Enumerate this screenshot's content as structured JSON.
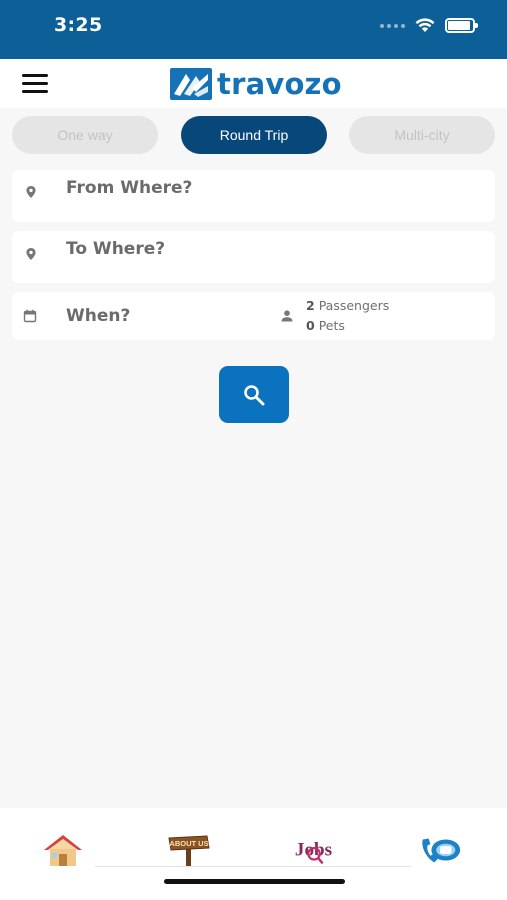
{
  "status_bar": {
    "time": "3:25",
    "icons": [
      "signal-icon",
      "wifi-icon",
      "battery-icon"
    ]
  },
  "header": {
    "menu_icon": "hamburger-menu-icon",
    "logo_text": "travozo"
  },
  "trip_types": [
    {
      "label": "One way",
      "active": false
    },
    {
      "label": "Round Trip",
      "active": true
    },
    {
      "label": "Multi-city",
      "active": false
    }
  ],
  "form": {
    "from": {
      "icon": "location-pin-icon",
      "text": "From Where?"
    },
    "to": {
      "icon": "location-pin-icon",
      "text": "To Where?"
    },
    "when": {
      "icon": "calendar-icon",
      "text": "When?"
    },
    "travelers": {
      "icon": "person-icon",
      "passengers_count": "2",
      "passengers_label": "Passengers",
      "pets_count": "0",
      "pets_label": "Pets"
    },
    "search_icon": "search-icon"
  },
  "bottom_nav": [
    {
      "name": "home",
      "icon": "home-icon"
    },
    {
      "name": "about-us",
      "icon": "about-us-sign-icon",
      "sign_text": "ABOUT US"
    },
    {
      "name": "jobs",
      "icon": "jobs-icon",
      "sign_text": "Jobs"
    },
    {
      "name": "contact",
      "icon": "contact-phone-icon"
    }
  ],
  "colors": {
    "brand_blue": "#0c5f97",
    "active_tab": "#08477a",
    "search_button": "#0a72be",
    "logo_blue": "#1672b6"
  }
}
